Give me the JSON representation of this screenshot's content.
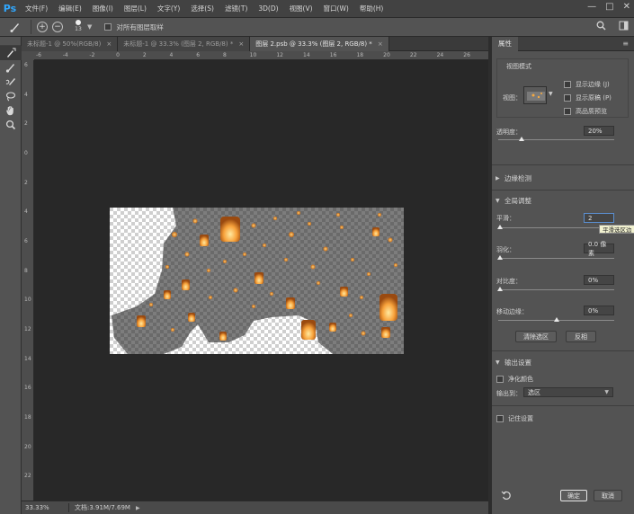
{
  "app": {
    "logo": "Ps",
    "menu": [
      "文件(F)",
      "编辑(E)",
      "图像(I)",
      "图层(L)",
      "文字(Y)",
      "选择(S)",
      "滤镜(T)",
      "3D(D)",
      "视图(V)",
      "窗口(W)",
      "帮助(H)"
    ],
    "window_controls": [
      "—",
      "□",
      "✕"
    ]
  },
  "options_bar": {
    "brush_size": "13",
    "sample_all_layers_label": "对所有图层取样"
  },
  "tools": [
    "refine-radius-tool",
    "brush-tool",
    "refine-edge-brush-tool",
    "lasso-tool",
    "hand-tool",
    "zoom-tool"
  ],
  "tabs": [
    {
      "label": "未标题-1 @ 50%(RGB/8)",
      "active": false
    },
    {
      "label": "未标题-1 @ 33.3% (图层 2, RGB/8) *",
      "active": false
    },
    {
      "label": "图层 2.psb @ 33.3% (图层 2, RGB/8) *",
      "active": true
    }
  ],
  "rulers": {
    "horizontal": [
      "-6",
      "-4",
      "-2",
      "0",
      "2",
      "4",
      "6",
      "8",
      "10",
      "12",
      "14",
      "16",
      "18",
      "20",
      "22",
      "24",
      "26"
    ],
    "vertical": [
      "6",
      "4",
      "2",
      "0",
      "2",
      "4",
      "6",
      "8",
      "10",
      "12",
      "14",
      "16",
      "18",
      "20",
      "22"
    ]
  },
  "status": {
    "zoom": "33.33%",
    "doc": "文档:3.91M/7.69M"
  },
  "properties": {
    "tab_label": "属性",
    "view_mode": {
      "title": "视图模式",
      "view_label": "视图：",
      "show_edge": "显示边缘 (J)",
      "show_original": "显示原稿 (P)",
      "high_quality": "高品质预览"
    },
    "opacity": {
      "label": "透明度：",
      "value": "20%"
    },
    "edge_detection": {
      "title": "边缘检测"
    },
    "global_refinements": {
      "title": "全局调整",
      "smooth": {
        "label": "平滑：",
        "value": "2"
      },
      "feather": {
        "label": "羽化：",
        "value": "0.0 像素"
      },
      "contrast": {
        "label": "对比度：",
        "value": "0%"
      },
      "shift_edge": {
        "label": "移动边缘：",
        "value": "0%"
      },
      "clear_selection": "清除选区",
      "invert": "反相",
      "tooltip": "平滑选区边"
    },
    "output": {
      "title": "输出设置",
      "decontaminate": "净化颜色",
      "output_to_label": "输出到：",
      "output_to_value": "选区"
    },
    "remember_settings": "记住设置",
    "ok": "确定",
    "cancel": "取消",
    "reset_icon": "reset-icon"
  }
}
